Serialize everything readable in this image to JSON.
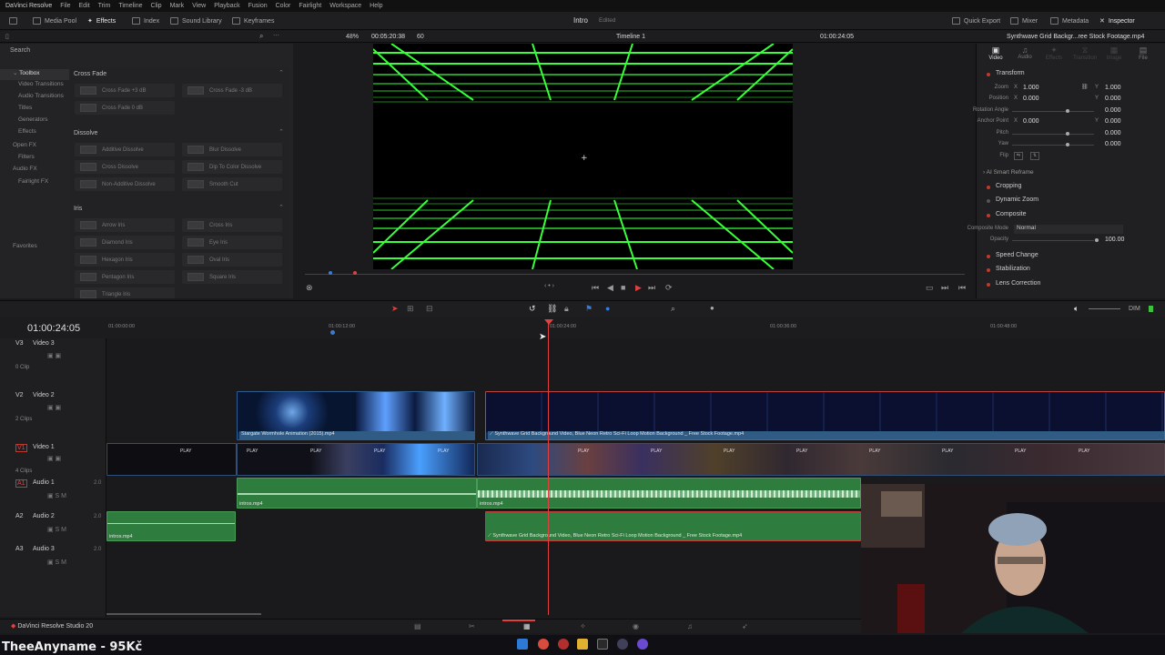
{
  "menubar": {
    "app": "DaVinci Resolve",
    "items": [
      "File",
      "Edit",
      "Trim",
      "Timeline",
      "Clip",
      "Mark",
      "View",
      "Playback",
      "Fusion",
      "Color",
      "Fairlight",
      "Workspace",
      "Help"
    ]
  },
  "toolbar": {
    "media_pool": "Media Pool",
    "effects": "Effects",
    "index": "Index",
    "sound_library": "Sound Library",
    "keyframes": "Keyframes",
    "quick_export": "Quick Export",
    "mixer": "Mixer",
    "metadata": "Metadata",
    "inspector": "Inspector"
  },
  "project": {
    "title": "Intro",
    "status": "Edited"
  },
  "viewer_bar": {
    "zoom": "48%",
    "source_tc": "00:05:20:38",
    "fps": "60",
    "timeline_name": "Timeline 1",
    "record_tc": "01:00:24:05",
    "clip_name": "Synthwave Grid Backgr...ree Stock Footage.mp4"
  },
  "effects": {
    "search": "Search",
    "tree": [
      "Toolbox",
      "Video Transitions",
      "Audio Transitions",
      "Titles",
      "Generators",
      "Effects",
      "Open FX",
      "Filters",
      "Audio FX",
      "Fairlight FX"
    ],
    "favorites": "Favorites",
    "categories": [
      {
        "name": "Cross Fade",
        "items": [
          "Cross Fade +3 dB",
          "Cross Fade -3 dB",
          "Cross Fade 0 dB"
        ]
      },
      {
        "name": "Dissolve",
        "items": [
          "Additive Dissolve",
          "Blur Dissolve",
          "Cross Dissolve",
          "Dip To Color Dissolve",
          "Non-Additive Dissolve",
          "Smooth Cut"
        ]
      },
      {
        "name": "Iris",
        "items": [
          "Arrow Iris",
          "Cross Iris",
          "Diamond Iris",
          "Eye Iris",
          "Hexagon Iris",
          "Oval Iris",
          "Pentagon Iris",
          "Square Iris",
          "Triangle Iris"
        ]
      }
    ]
  },
  "inspector": {
    "tabs": [
      "Video",
      "Audio",
      "Effects",
      "Transition",
      "Image",
      "File"
    ],
    "transform": "Transform",
    "zoom_label": "Zoom",
    "zoom_x": "1.000",
    "zoom_y": "1.000",
    "position_label": "Position",
    "pos_x": "0.000",
    "pos_y": "0.000",
    "rotation_label": "Rotation Angle",
    "rotation": "0.000",
    "anchor_label": "Anchor Point",
    "anchor_x": "0.000",
    "anchor_y": "0.000",
    "pitch_label": "Pitch",
    "pitch": "0.000",
    "yaw_label": "Yaw",
    "yaw": "0.000",
    "flip_label": "Flip",
    "ai_reframe": "AI Smart Reframe",
    "cropping": "Cropping",
    "dynamic_zoom": "Dynamic Zoom",
    "composite": "Composite",
    "composite_mode_label": "Composite Mode",
    "composite_mode": "Normal",
    "opacity_label": "Opacity",
    "opacity": "100.00",
    "speed_change": "Speed Change",
    "stabilization": "Stabilization",
    "lens_correction": "Lens Correction"
  },
  "timeline": {
    "timecode": "01:00:24:05",
    "ruler": [
      "01:00:00:00",
      "01:00:12:00",
      "01:00:24:00",
      "01:00:36:00",
      "01:00:48:00"
    ],
    "dim": "DIM",
    "tracks": [
      {
        "id": "V3",
        "name": "Video 3",
        "count": "0 Clip"
      },
      {
        "id": "V2",
        "name": "Video 2",
        "count": "2 Clips"
      },
      {
        "id": "V1",
        "name": "Video 1",
        "count": "4 Clips"
      },
      {
        "id": "A1",
        "name": "Audio 1",
        "level": "2.0"
      },
      {
        "id": "A2",
        "name": "Audio 2",
        "level": "2.0"
      },
      {
        "id": "A3",
        "name": "Audio 3",
        "level": "2.0"
      }
    ],
    "clips": {
      "v2a": "Stargate Wormhole Animation (2015).mp4",
      "v2b": "Synthwave Grid Background Video, Blue Neon Retro Sci-Fi Loop Motion Background _ Free Stock Footage.mp4",
      "play": "PLAY",
      "a1a": "intros.mp4",
      "a1b": "intros.mp4",
      "a2a": "intros.mp4",
      "a2b": "Synthwave Grid Background Video, Blue Neon Retro Sci-Fi Loop Motion Background _ Free Stock Footage.mp4"
    }
  },
  "pagebar": {
    "product": "DaVinci Resolve Studio 20"
  },
  "overlay": {
    "donation": "TheeAnyname - 95Kč"
  },
  "colors": {
    "grid_green": "#39ff3a",
    "playhead": "#e04040",
    "video_clip": "#2f5b84",
    "audio_clip": "#2f7d3e"
  }
}
